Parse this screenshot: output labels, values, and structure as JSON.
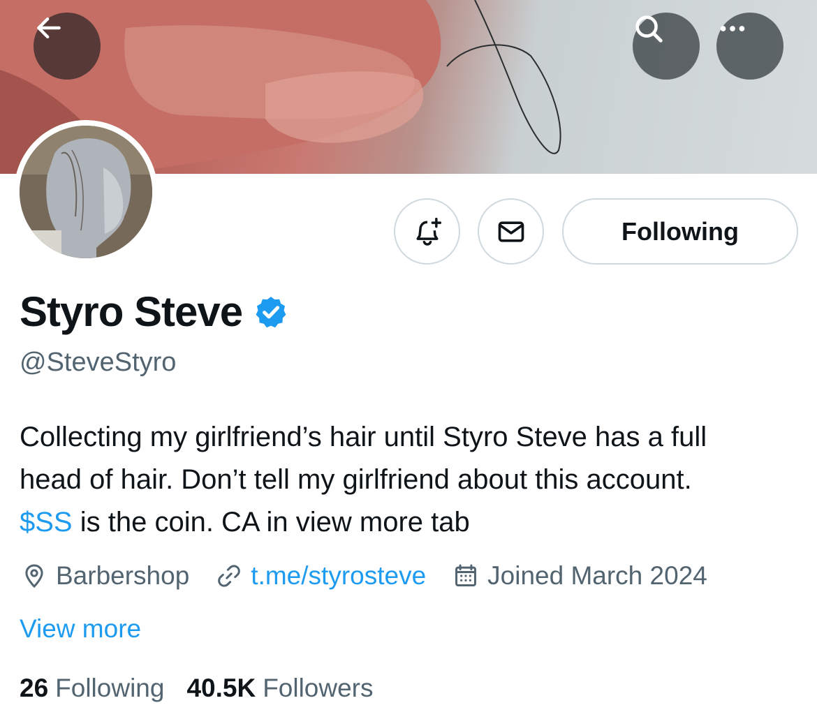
{
  "header": {
    "back_icon": "arrow-left-icon",
    "search_icon": "search-icon",
    "more_icon": "more-horizontal-icon"
  },
  "profile": {
    "display_name": "Styro Steve",
    "verified": true,
    "handle": "@SteveStyro",
    "bio_line_1": "Collecting my girlfriend’s hair until Styro Steve has a full",
    "bio_line_2": "head of hair. Don’t tell my girlfriend about this account.",
    "bio_cashtag": "$SS",
    "bio_line_3_rest": " is the coin. CA in view more tab",
    "location": "Barbershop",
    "link": "t.me/styrosteve",
    "joined": "Joined March 2024",
    "view_more": "View more"
  },
  "actions": {
    "notify_icon": "bell-plus-icon",
    "message_icon": "mail-icon",
    "following_label": "Following"
  },
  "stats": {
    "following_count": "26",
    "following_label": "Following",
    "followers_count": "40.5K",
    "followers_label": "Followers"
  },
  "colors": {
    "accent": "#1d9bf0",
    "text_primary": "#0f1419",
    "text_secondary": "#536471",
    "border": "#cfd9de"
  }
}
